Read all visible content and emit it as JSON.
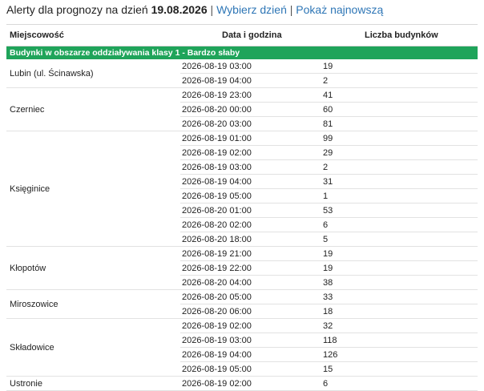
{
  "header": {
    "prefix": "Alerty dla prognozy na dzień",
    "date": "19.08.2026",
    "sep1": "|",
    "choose_day": "Wybierz dzień",
    "sep2": "|",
    "show_latest": "Pokaż najnowszą"
  },
  "table": {
    "columns": [
      "Miejscowość",
      "Data i godzina",
      "Liczba budynków"
    ],
    "class_label": "Budynki w obszarze oddziaływania klasy 1 - Bardzo słaby",
    "groups": [
      {
        "place": "Lubin (ul. Ścinawska)",
        "rows": [
          [
            "2026-08-19 03:00",
            "19"
          ],
          [
            "2026-08-19 04:00",
            "2"
          ]
        ]
      },
      {
        "place": "Czerniec",
        "rows": [
          [
            "2026-08-19 23:00",
            "41"
          ],
          [
            "2026-08-20 00:00",
            "60"
          ],
          [
            "2026-08-20 03:00",
            "81"
          ]
        ]
      },
      {
        "place": "Księginice",
        "rows": [
          [
            "2026-08-19 01:00",
            "99"
          ],
          [
            "2026-08-19 02:00",
            "29"
          ],
          [
            "2026-08-19 03:00",
            "2"
          ],
          [
            "2026-08-19 04:00",
            "31"
          ],
          [
            "2026-08-19 05:00",
            "1"
          ],
          [
            "2026-08-20 01:00",
            "53"
          ],
          [
            "2026-08-20 02:00",
            "6"
          ],
          [
            "2026-08-20 18:00",
            "5"
          ]
        ]
      },
      {
        "place": "Kłopotów",
        "rows": [
          [
            "2026-08-19 21:00",
            "19"
          ],
          [
            "2026-08-19 22:00",
            "19"
          ],
          [
            "2026-08-20 04:00",
            "38"
          ]
        ]
      },
      {
        "place": "Miroszowice",
        "rows": [
          [
            "2026-08-20 05:00",
            "33"
          ],
          [
            "2026-08-20 06:00",
            "18"
          ]
        ]
      },
      {
        "place": "Składowice",
        "rows": [
          [
            "2026-08-19 02:00",
            "32"
          ],
          [
            "2026-08-19 03:00",
            "118"
          ],
          [
            "2026-08-19 04:00",
            "126"
          ],
          [
            "2026-08-19 05:00",
            "15"
          ]
        ]
      },
      {
        "place": "Ustronie",
        "rows": [
          [
            "2026-08-19 02:00",
            "6"
          ]
        ]
      }
    ]
  },
  "colors": {
    "class_row_bg": "#1fa45a",
    "link": "#2e76b6"
  }
}
